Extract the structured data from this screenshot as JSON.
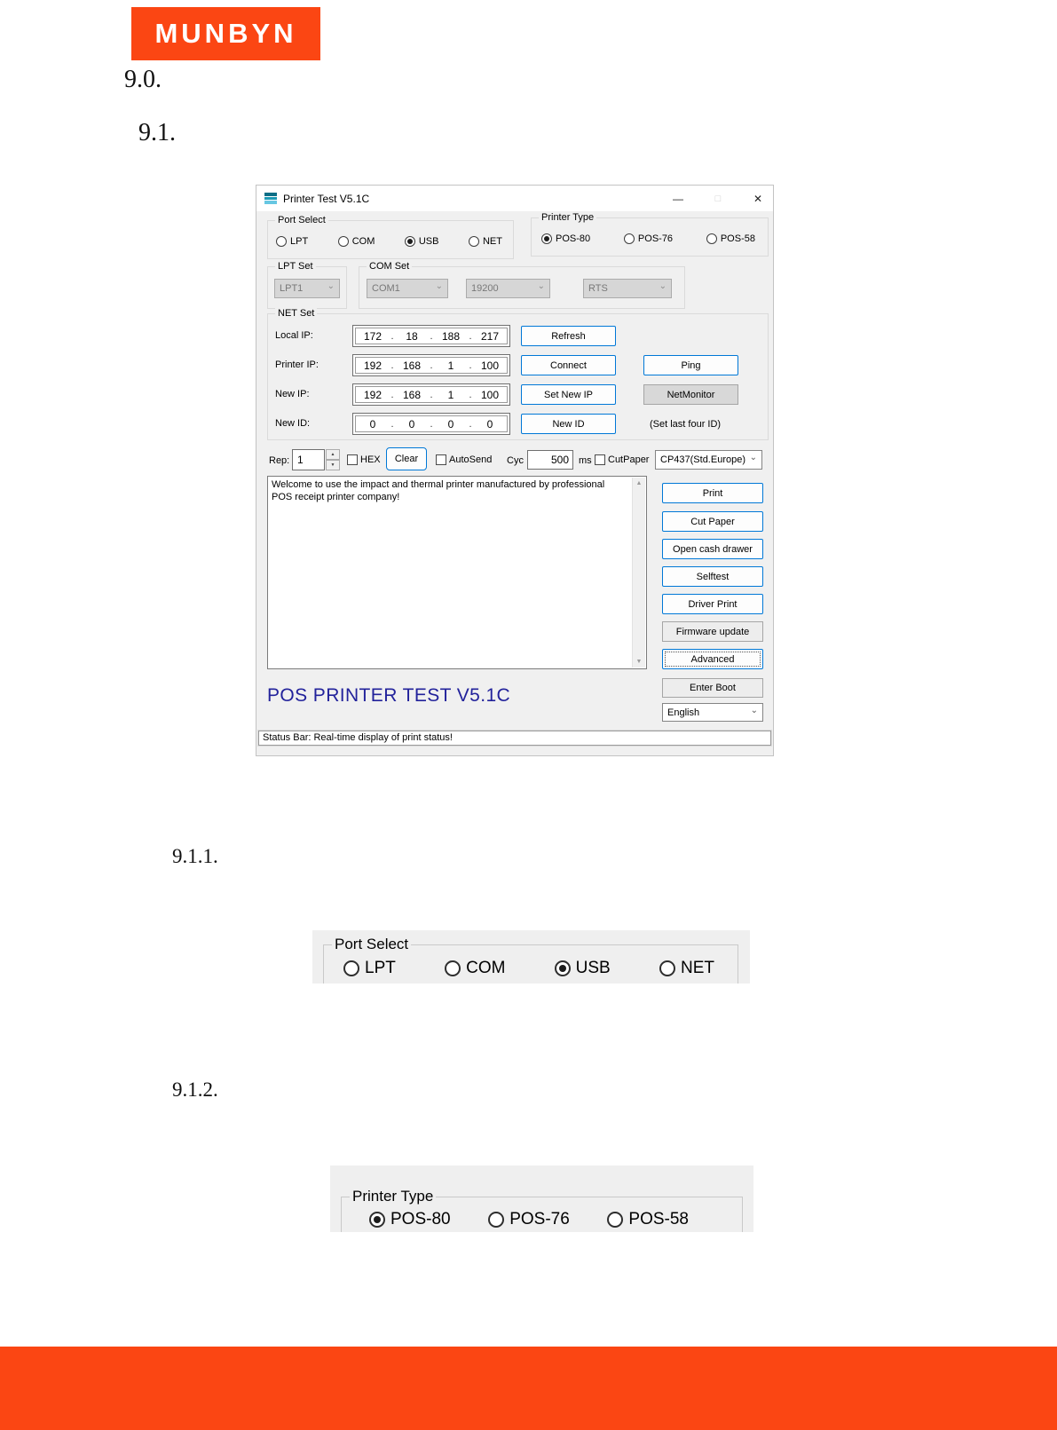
{
  "brand": {
    "logo": "MUNBYN",
    "color": "#FB4613"
  },
  "headings": {
    "s90": "9.0.",
    "s91": "9.1.",
    "s911": "9.1.1.",
    "s912": "9.1.2."
  },
  "icons": {
    "minimize": "—",
    "maximize": "□",
    "close": "✕",
    "chevron": "⌄",
    "up": "▲",
    "down": "▼"
  },
  "window": {
    "title": "Printer Test V5.1C",
    "port_select": {
      "label": "Port Select",
      "options": [
        "LPT",
        "COM",
        "USB",
        "NET"
      ],
      "selected": "USB"
    },
    "printer_type": {
      "label": "Printer Type",
      "options": [
        "POS-80",
        "POS-76",
        "POS-58"
      ],
      "selected": "POS-80"
    },
    "lpt_set": {
      "label": "LPT Set",
      "value": "LPT1"
    },
    "com_set": {
      "label": "COM Set",
      "port": "COM1",
      "baud": "19200",
      "flow": "RTS"
    },
    "net_set": {
      "label": "NET Set",
      "rows": [
        {
          "label": "Local IP:",
          "ip": [
            "172",
            "18",
            "188",
            "217"
          ],
          "button": "Refresh"
        },
        {
          "label": "Printer IP:",
          "ip": [
            "192",
            "168",
            "1",
            "100"
          ],
          "button": "Connect",
          "button2": "Ping"
        },
        {
          "label": "New IP:",
          "ip": [
            "192",
            "168",
            "1",
            "100"
          ],
          "button": "Set New IP",
          "button2": "NetMonitor"
        },
        {
          "label": "New ID:",
          "ip": [
            "0",
            "0",
            "0",
            "0"
          ],
          "button": "New ID",
          "note": "(Set last four ID)"
        }
      ]
    },
    "controls": {
      "rep_label": "Rep:",
      "rep_value": "1",
      "hex_label": "HEX",
      "clear_label": "Clear",
      "autosend_label": "AutoSend",
      "cyc_label": "Cyc",
      "cyc_value": "500",
      "ms_label": "ms",
      "cutpaper_label": "CutPaper",
      "codepage": "CP437(Std.Europe)"
    },
    "message": "Welcome to use the impact and thermal printer manufactured by professional POS receipt printer company!",
    "action_buttons": [
      "Print",
      "Cut Paper",
      "Open cash drawer",
      "Selftest",
      "Driver Print",
      "Firmware update",
      "Advanced"
    ],
    "enter_boot": "Enter Boot",
    "language": "English",
    "watermark": "POS PRINTER TEST V5.1C",
    "status_bar": "Status Bar: Real-time display of print status!"
  },
  "crops": {
    "port_select": {
      "label": "Port Select",
      "options": [
        "LPT",
        "COM",
        "USB",
        "NET"
      ],
      "selected": "USB"
    },
    "printer_type": {
      "label": "Printer Type",
      "options": [
        "POS-80",
        "POS-76",
        "POS-58"
      ],
      "selected": "POS-80"
    }
  }
}
